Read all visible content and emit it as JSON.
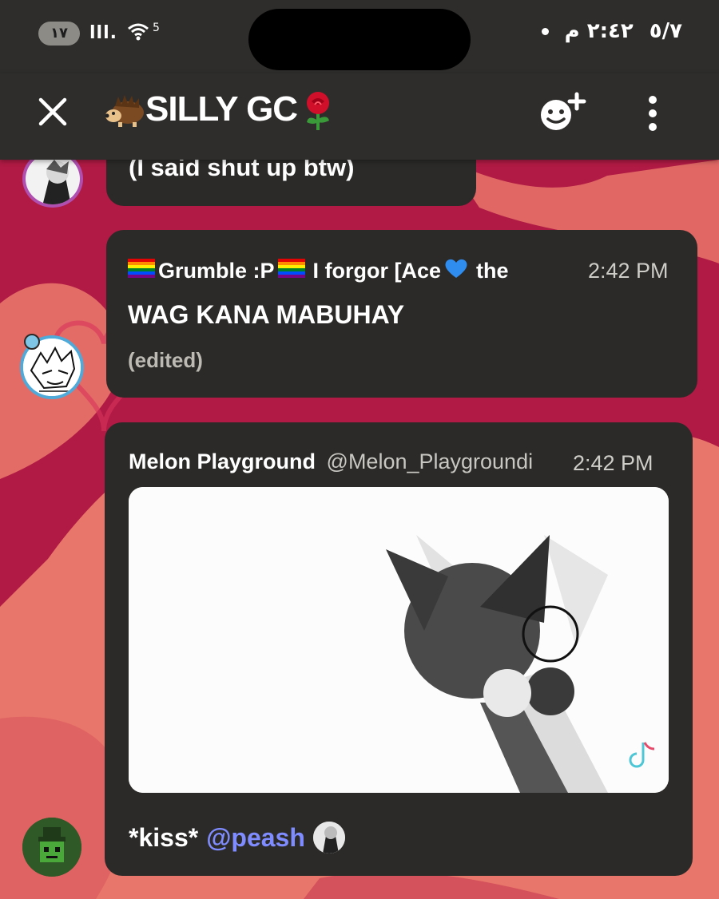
{
  "status_bar": {
    "battery": "١٧",
    "signal": "lll.",
    "wifi_badge": "5",
    "time": "٢:٤٢ م",
    "date": "٥/٧"
  },
  "app_bar": {
    "title": "SILLY GC",
    "title_prefix_icon": "hedgehog-emoji",
    "title_suffix_icon": "rose-emoji",
    "close_icon": "close-icon",
    "add_member_icon": "add-member-icon",
    "more_icon": "more-vert-icon"
  },
  "messages": [
    {
      "id": "prev",
      "text": "(I said shut up btw)"
    },
    {
      "id": "grumble",
      "author": "Grumble :P",
      "author_suffix": "I forgor [Ace",
      "author_tail": "the Q",
      "time": "2:42 PM",
      "text": "WAG KANA MABUHAY",
      "edited": "(edited)"
    },
    {
      "id": "melon",
      "author": "Melon Playground",
      "handle": "@Melon_Playgroundi",
      "time": "2:42 PM",
      "text": "*kiss*",
      "mention": "@peash"
    }
  ],
  "colors": {
    "bar_bg": "#2e2d2b",
    "bubble_bg": "#2b2a28",
    "mention": "#7f8cff",
    "background_red": "#b11b45",
    "background_coral": "#e9766a"
  }
}
